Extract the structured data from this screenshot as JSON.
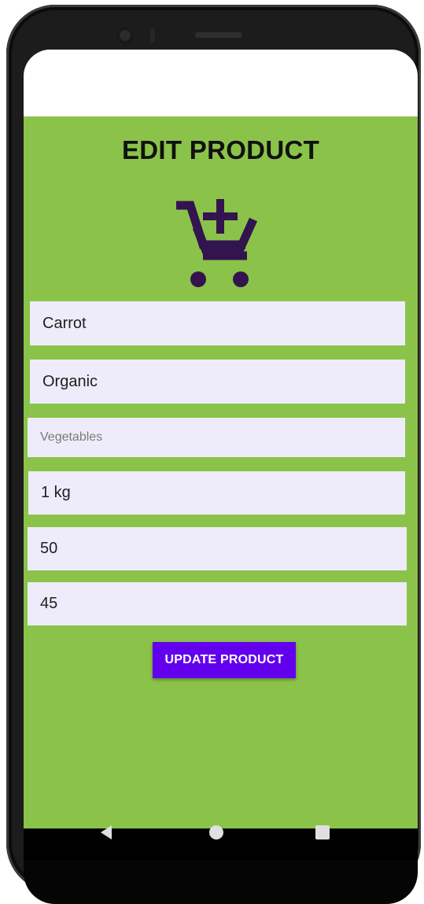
{
  "app": {
    "title": "EDIT PRODUCT",
    "icon": "add-shopping-cart-icon"
  },
  "fields": [
    {
      "name": "product-name",
      "value": "Carrot",
      "placeholder": ""
    },
    {
      "name": "product-type",
      "value": "Organic",
      "placeholder": ""
    },
    {
      "name": "product-category",
      "value": "",
      "placeholder": "Vegetables"
    },
    {
      "name": "product-quantity",
      "value": "1 kg",
      "placeholder": ""
    },
    {
      "name": "product-price",
      "value": "50",
      "placeholder": ""
    },
    {
      "name": "product-discount-price",
      "value": "45",
      "placeholder": ""
    }
  ],
  "actions": {
    "update_label": "UPDATE PRODUCT"
  },
  "navbar": {
    "icons": [
      "back-icon",
      "home-icon",
      "recents-icon"
    ]
  },
  "colors": {
    "background": "#8bc34a",
    "field": "#eeecfa",
    "button": "#6200ee",
    "icon": "#33144f"
  }
}
